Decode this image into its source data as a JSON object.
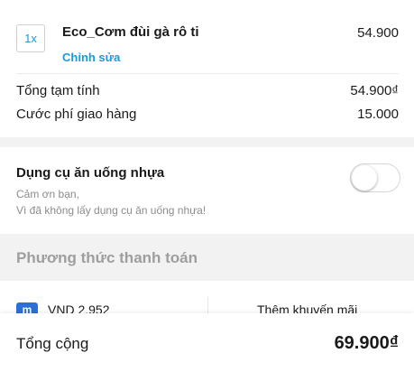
{
  "order": {
    "quantity": "1x",
    "item_name": "Eco_Cơm đùi gà rô ti",
    "item_price": "54.900",
    "edit_label": "Chỉnh sửa"
  },
  "summary": {
    "subtotal_label": "Tổng tạm tính",
    "subtotal_value": "54.900₫",
    "delivery_label": "Cước phí giao hàng",
    "delivery_value": "15.000"
  },
  "utensils": {
    "title": "Dụng cụ ăn uống nhựa",
    "desc_line1": "Cảm ơn bạn,",
    "desc_line2": "Vì đã không lấy dụng cụ ăn uống nhựa!",
    "toggle_on": false
  },
  "payment": {
    "section_title": "Phương thức thanh toán",
    "wallet_icon": "m",
    "wallet_amount": "VND 2.952",
    "promo_label": "Thêm khuyến mãi"
  },
  "total": {
    "label": "Tổng cộng",
    "value": "69.900₫"
  },
  "colors": {
    "accent": "#1a9ad6",
    "wallet": "#2c6fd6"
  }
}
